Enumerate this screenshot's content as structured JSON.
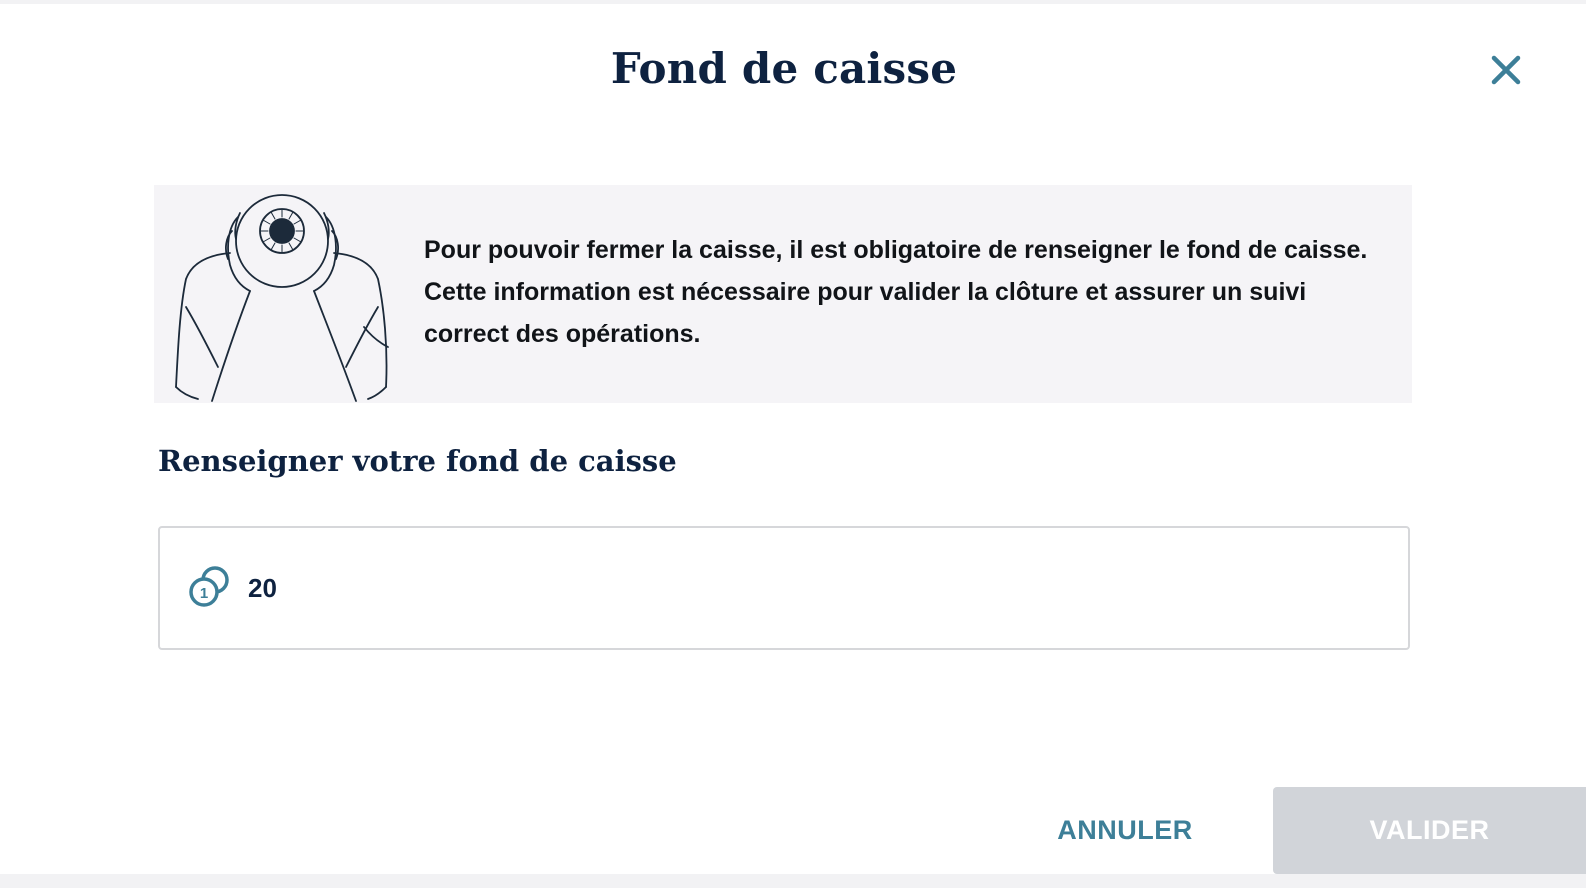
{
  "modal": {
    "title": "Fond de caisse",
    "close_icon": "close-icon"
  },
  "info": {
    "text": "Pour pouvoir fermer la caisse, il est obligatoire de renseigner le fond de caisse. Cette information est nécessaire pour valider la clôture et assurer un suivi correct des opérations.",
    "illustration": "person-holding-eye-illustration"
  },
  "form": {
    "label": "Renseigner votre fond de caisse",
    "amount_value": "20",
    "amount_icon": "coins-icon"
  },
  "actions": {
    "cancel_label": "ANNULER",
    "validate_label": "VALIDER"
  },
  "colors": {
    "title": "#0e2240",
    "accent": "#3d7f98",
    "info_background": "#f5f4f7",
    "disabled_button": "#d1d4d9"
  }
}
